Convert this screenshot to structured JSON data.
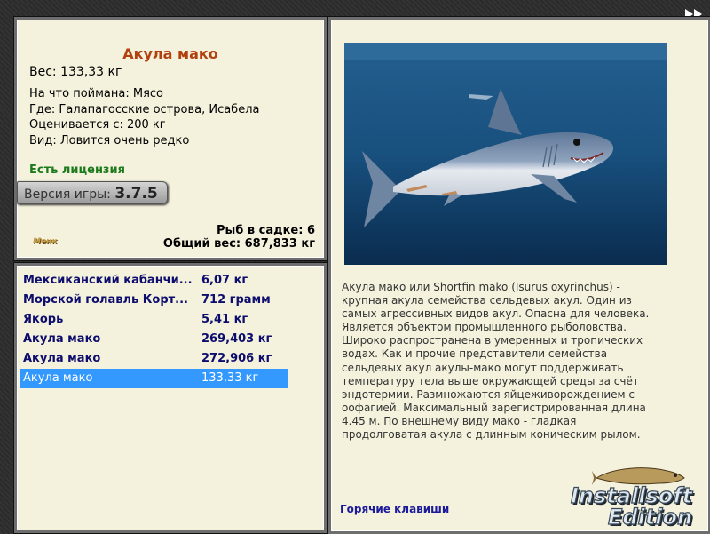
{
  "fish": {
    "name": "Акула мако",
    "weight_line": "Вес: 133,33 кг",
    "bait_line": "На что поймана: Мясо",
    "place_line": "Где: Галапагосские острова, Исабела",
    "value_line": "Оценивается с: 200 кг",
    "rarity_line": "Вид: Ловится очень редко",
    "license": "Есть лицензия"
  },
  "version": {
    "label": "Версия игры:",
    "number": "3.7.5"
  },
  "cage": {
    "count_line": "Рыб в садке: 6",
    "total_line": "Общий вес: 687,833 кг"
  },
  "small_logo": "Менк",
  "catch_list": [
    {
      "name": "Мексиканский кабанчи...",
      "weight": "6,07 кг"
    },
    {
      "name": "Морской голавль Корт...",
      "weight": "712 грамм"
    },
    {
      "name": "Якорь",
      "weight": "5,41 кг"
    },
    {
      "name": "Акула мако",
      "weight": "269,403 кг"
    },
    {
      "name": "Акула мако",
      "weight": "272,906 кг"
    },
    {
      "name": "Акула мако",
      "weight": "133,33 кг"
    }
  ],
  "selected_index": 5,
  "description": "Акула мако или Shortfin mako (Isurus oxyrinchus) - крупная акула семейства сельдевых акул. Один из самых агрессивных видов акул. Опасна для человека. Является объектом промышленного рыболовства. Широко распространена в умеренных и тропических водах. Как и прочие представители семейства сельдевых акул акулы-мако могут поддерживать температуру тела выше окружающей среды за счёт эндотермии. Размножаются яйцеживорождением с оофагией. Максимальный зарегистрированная длина 4.45 м. По внешнему виду мако - гладкая продолговатая акула с длинным коническим рылом.",
  "hotkeys": "Горячие клавиши",
  "watermark": {
    "line1": "Installsoft",
    "line2": "Edition"
  },
  "icons": {
    "skip": "fast-forward-icon",
    "photo": "shark-photo"
  },
  "colors": {
    "title": "#b2410f",
    "license": "#1b7a1b",
    "list_text": "#0d0d6e",
    "selection": "#3399ff",
    "panel": "#f4f1dc"
  }
}
